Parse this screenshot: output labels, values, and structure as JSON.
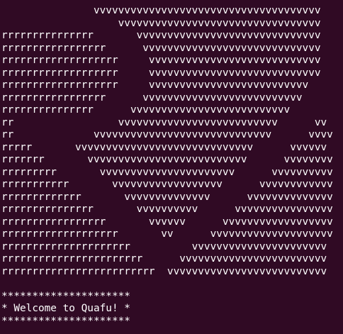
{
  "terminal": {
    "background": "#300a24",
    "foreground": "#ffffff",
    "lines": [
      "               vvvvvvvvvvvvvvvvvvvvvvvvvvvvvvvvvvvvv",
      "                   vvvvvvvvvvvvvvvvvvvvvvvvvvvvvvvvv",
      "rrrrrrrrrrrrrrr       vvvvvvvvvvvvvvvvvvvvvvvvvvvvvv",
      "rrrrrrrrrrrrrrrrr      vvvvvvvvvvvvvvvvvvvvvvvvvvvvv",
      "rrrrrrrrrrrrrrrrrrr     vvvvvvvvvvvvvvvvvvvvvvvvvvvv",
      "rrrrrrrrrrrrrrrrrrr     vvvvvvvvvvvvvvvvvvvvvvvvvvvv",
      "rrrrrrrrrrrrrrrrrrr     vvvvvvvvvvvvvvvvvvvvvvvvvv",
      "rrrrrrrrrrrrrrrrr      vvvvvvvvvvvvvvvvvvvvvvvvvv",
      "rrrrrrrrrrrrrrr      vvvvvvvvvvvvvvvvvvvvvvvvvv",
      "rr                 vvvvvvvvvvvvvvvvvvvvvvvvvv      vv",
      "rr             vvvvvvvvvvvvvvvvvvvvvvvvvvvvv      vvvv",
      "rrrrr       vvvvvvvvvvvvvvvvvvvvvvvvvvvvv      vvvvvv",
      "rrrrrrr       vvvvvvvvvvvvvvvvvvvvvvvvvv      vvvvvvvv",
      "rrrrrrrrr       vvvvvvvvvvvvvvvvvvvvvv      vvvvvvvvvv",
      "rrrrrrrrrrr       vvvvvvvvvvvvvvvvvv      vvvvvvvvvvvv",
      "rrrrrrrrrrrrr       vvvvvvvvvvvvvv      vvvvvvvvvvvvvv",
      "rrrrrrrrrrrrrrr       vvvvvvvvvv      vvvvvvvvvvvvvvvv",
      "rrrrrrrrrrrrrrrrr       vvvvvv      vvvvvvvvvvvvvvvvvv",
      "rrrrrrrrrrrrrrrrrrr       vv      vvvvvvvvvvvvvvvvvvvv",
      "rrrrrrrrrrrrrrrrrrrrr          vvvvvvvvvvvvvvvvvvvvvv",
      "rrrrrrrrrrrrrrrrrrrrrrr      vvvvvvvvvvvvvvvvvvvvvvvv",
      "rrrrrrrrrrrrrrrrrrrrrrrrr  vvvvvvvvvvvvvvvvvvvvvvvvvv",
      "",
      "*********************",
      "* Welcome to Quafu! *",
      "*********************"
    ]
  }
}
